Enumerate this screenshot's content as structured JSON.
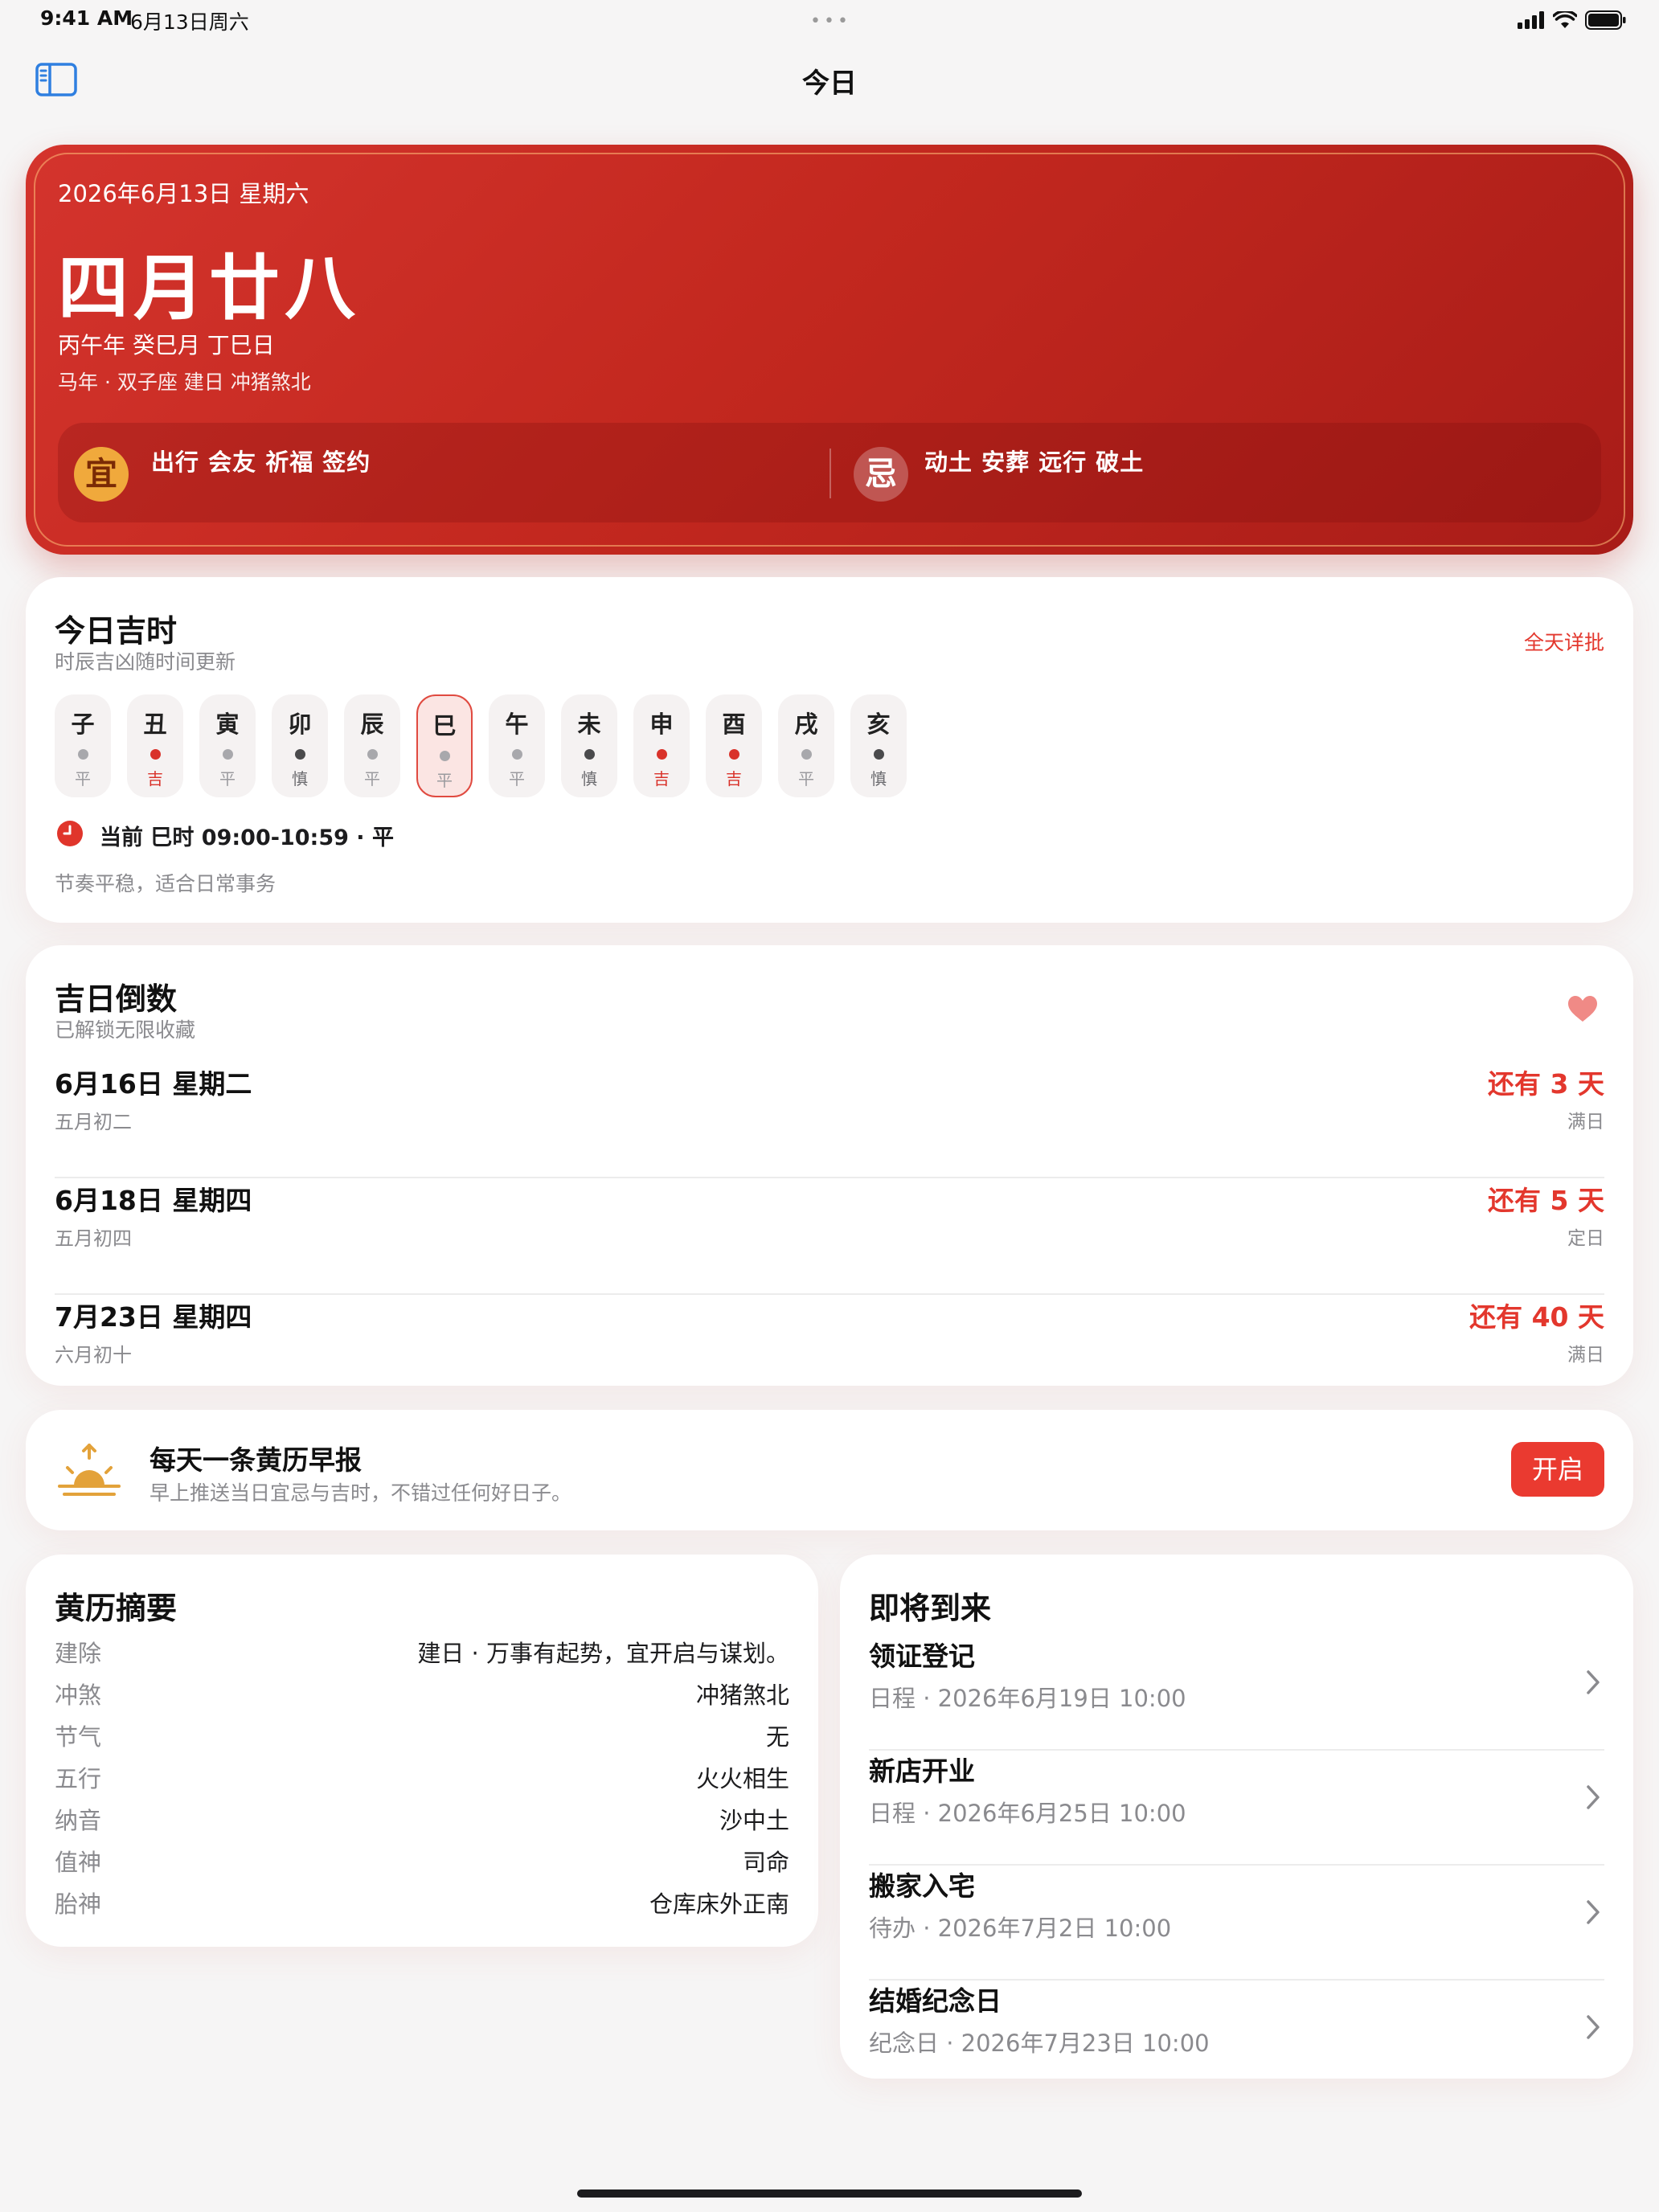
{
  "status_bar": {
    "time": "9:41 AM",
    "date": "6月13日周六",
    "dots": "•••"
  },
  "nav": {
    "title": "今日",
    "sidebar_icon": "sidebar-toggle-icon"
  },
  "hero": {
    "date": "2026年6月13日  星期六",
    "lunar": "四月廿八",
    "ganzhi": "丙午年 癸巳月 丁巳日",
    "meta": "马年 · 双子座   建日   冲猪煞北",
    "yi_badge": "宜",
    "yi": "出行 会友 祈福 签约",
    "ji_badge": "忌",
    "ji": "动土 安葬 远行 破土",
    "colors": {
      "card": "#c72d25",
      "yi_badge": "#f0a93c"
    }
  },
  "jishi": {
    "title": "今日吉时",
    "subtitle": "时辰吉凶随时间更新",
    "detail_link": "全天详批",
    "hours": [
      {
        "name": "子",
        "level": "平",
        "status": "neutral"
      },
      {
        "name": "丑",
        "level": "吉",
        "status": "good"
      },
      {
        "name": "寅",
        "level": "平",
        "status": "neutral"
      },
      {
        "name": "卯",
        "level": "慎",
        "status": "caution"
      },
      {
        "name": "辰",
        "level": "平",
        "status": "neutral"
      },
      {
        "name": "巳",
        "level": "平",
        "status": "neutral",
        "current": true
      },
      {
        "name": "午",
        "level": "平",
        "status": "neutral"
      },
      {
        "name": "未",
        "level": "慎",
        "status": "caution"
      },
      {
        "name": "申",
        "level": "吉",
        "status": "good"
      },
      {
        "name": "酉",
        "level": "吉",
        "status": "good"
      },
      {
        "name": "戌",
        "level": "平",
        "status": "neutral"
      },
      {
        "name": "亥",
        "level": "慎",
        "status": "caution"
      }
    ],
    "current": "当前 巳时 09:00-10:59 · 平",
    "current_desc": "节奏平稳，适合日常事务",
    "colors": {
      "good": "#d9322a",
      "neutral": "#a8a8ac",
      "caution": "#4a4a4c"
    }
  },
  "countdown": {
    "title": "吉日倒数",
    "subtitle": "已解锁无限收藏",
    "icon": "heart-icon",
    "items": [
      {
        "date": "6月16日 星期二",
        "lunar": "五月初二",
        "left": "还有 3 天",
        "type": "满日"
      },
      {
        "date": "6月18日 星期四",
        "lunar": "五月初四",
        "left": "还有 5 天",
        "type": "定日"
      },
      {
        "date": "7月23日 星期四",
        "lunar": "六月初十",
        "left": "还有 40 天",
        "type": "满日"
      }
    ]
  },
  "morning": {
    "icon": "sunrise-icon",
    "title": "每天一条黄历早报",
    "subtitle": "早上推送当日宜忌与吉时，不错过任何好日子。",
    "button": "开启"
  },
  "summary": {
    "title": "黄历摘要",
    "rows": [
      {
        "key": "建除",
        "value": "建日 · 万事有起势，宜开启与谋划。"
      },
      {
        "key": "冲煞",
        "value": "冲猪煞北"
      },
      {
        "key": "节气",
        "value": "无"
      },
      {
        "key": "五行",
        "value": "火火相生"
      },
      {
        "key": "纳音",
        "value": "沙中土"
      },
      {
        "key": "值神",
        "value": "司命"
      },
      {
        "key": "胎神",
        "value": "仓库床外正南"
      }
    ]
  },
  "upcoming": {
    "title": "即将到来",
    "items": [
      {
        "title": "领证登记",
        "sub": "日程 · 2026年6月19日 10:00"
      },
      {
        "title": "新店开业",
        "sub": "日程 · 2026年6月25日 10:00"
      },
      {
        "title": "搬家入宅",
        "sub": "待办 · 2026年7月2日 10:00"
      },
      {
        "title": "结婚纪念日",
        "sub": "纪念日 · 2026年7月23日 10:00"
      }
    ]
  }
}
